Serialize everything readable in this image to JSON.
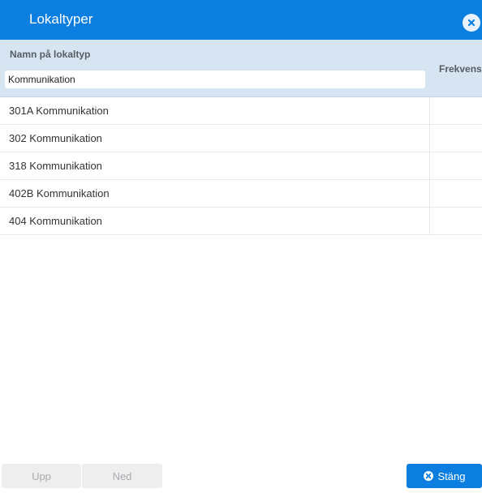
{
  "dialog": {
    "title": "Lokaltyper"
  },
  "table": {
    "columns": {
      "name": "Namn på lokaltyp",
      "frequency": "Frekvens"
    },
    "filter": {
      "value": "Kommunikation"
    },
    "rows": [
      {
        "name": "301A Kommunikation"
      },
      {
        "name": "302 Kommunikation"
      },
      {
        "name": "318 Kommunikation"
      },
      {
        "name": "402B Kommunikation"
      },
      {
        "name": "404 Kommunikation"
      }
    ]
  },
  "footer": {
    "up_label": "Upp",
    "down_label": "Ned",
    "close_label": "Stäng"
  },
  "colors": {
    "accent": "#0b7ee0",
    "header_bg": "#d7e5f2"
  },
  "icons": {
    "close": "close-circle-icon"
  }
}
